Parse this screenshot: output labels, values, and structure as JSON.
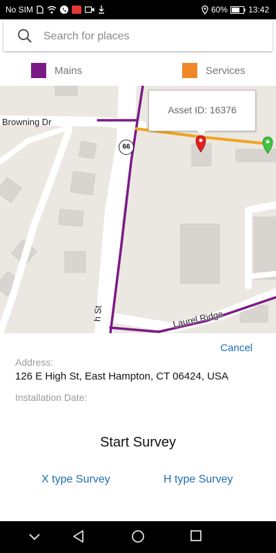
{
  "status_bar": {
    "carrier": "No SIM",
    "battery_percent": "60%",
    "time": "13:42"
  },
  "search": {
    "placeholder": "Search for places"
  },
  "legend": [
    {
      "label": "Mains",
      "color": "#7b1a86"
    },
    {
      "label": "Services",
      "color": "#f0882a"
    }
  ],
  "map": {
    "road_labels": {
      "browning": "Browning Dr",
      "laurel": "Laurel Ridge",
      "high_st_partial": "h St"
    },
    "route_number": "66",
    "callout": "Asset ID: 16376",
    "pins": [
      {
        "icon": "red-pin-icon",
        "color": "#e02020"
      },
      {
        "icon": "green-pin-icon",
        "color": "#3ec43e"
      }
    ]
  },
  "sheet": {
    "cancel_label": "Cancel",
    "address_label": "Address:",
    "address_value": "126 E High St, East Hampton, CT 06424, USA",
    "installation_label": "Installation Date:",
    "installation_value": "",
    "start_survey": "Start Survey",
    "x_survey": "X type Survey",
    "h_survey": "H type Survey"
  },
  "nav_bar": {
    "buttons": [
      "collapse-icon",
      "back-icon",
      "home-icon",
      "recents-icon"
    ]
  }
}
